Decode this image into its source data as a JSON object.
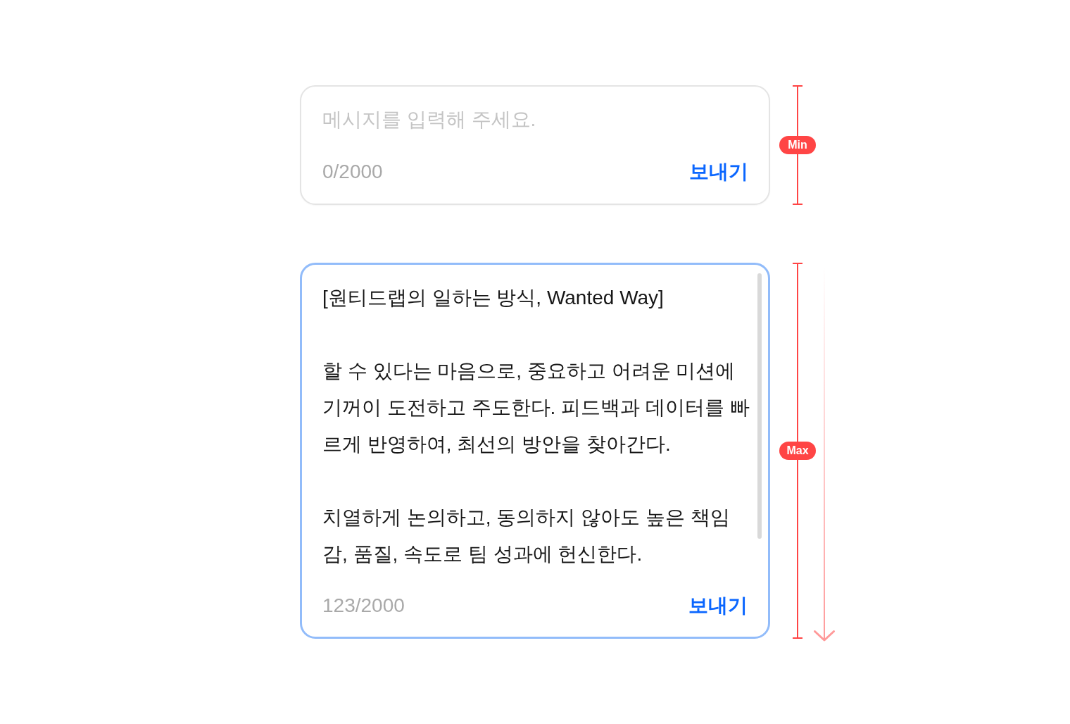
{
  "composers": [
    {
      "kind": "min",
      "focused": false,
      "placeholder": "메시지를 입력해 주세요.",
      "counter": "0/2000",
      "send_button": "보내기",
      "height_label": "Min"
    },
    {
      "kind": "max",
      "focused": true,
      "value": "[원티드랩의 일하는 방식, Wanted Way]\n\n할 수 있다는 마음으로, 중요하고 어려운 미션에 기꺼이 도전하고 주도한다. 피드백과 데이터를 빠르게 반영하여, 최선의 방안을 찾아간다.\n\n치열하게 논의하고, 동의하지 않아도 높은 책임감, 품질, 속도로 팀 성과에 헌신한다.",
      "counter": "123/2000",
      "send_button": "보내기",
      "height_label": "Max"
    }
  ]
}
